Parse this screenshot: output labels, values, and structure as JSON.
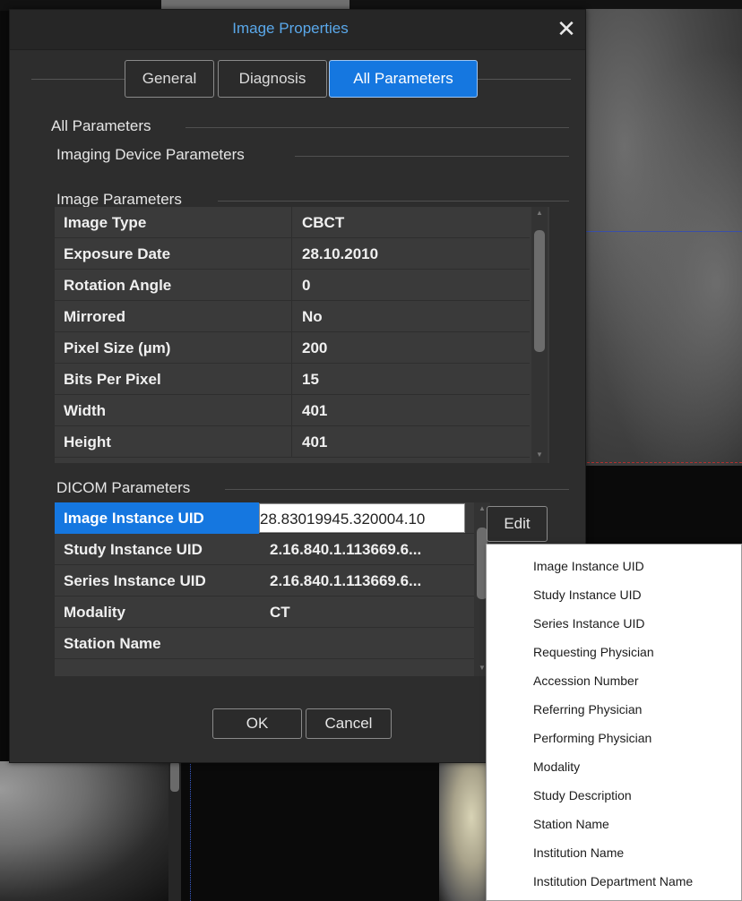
{
  "dialog": {
    "title": "Image Properties",
    "close_glyph": "✕",
    "tabs": [
      {
        "label": "General",
        "active": false
      },
      {
        "label": "Diagnosis",
        "active": false
      },
      {
        "label": "All Parameters",
        "active": true
      }
    ]
  },
  "sections": {
    "all_parameters": "All Parameters",
    "imaging_device": "Imaging Device Parameters",
    "image_parameters": "Image Parameters",
    "dicom_parameters": "DICOM Parameters"
  },
  "image_parameters": [
    {
      "key": "Image Type",
      "value": "CBCT"
    },
    {
      "key": "Exposure Date",
      "value": "28.10.2010"
    },
    {
      "key": "Rotation Angle",
      "value": "0"
    },
    {
      "key": "Mirrored",
      "value": "No"
    },
    {
      "key": "Pixel Size (µm)",
      "value": "200"
    },
    {
      "key": "Bits Per Pixel",
      "value": "15"
    },
    {
      "key": "Width",
      "value": "401"
    },
    {
      "key": "Height",
      "value": "401"
    }
  ],
  "dicom_parameters": [
    {
      "key": "Image Instance UID",
      "value": "28.83019945.320004.10",
      "selected": true,
      "editing": true
    },
    {
      "key": "Study Instance UID",
      "value": "2.16.840.1.113669.6..."
    },
    {
      "key": "Series Instance UID",
      "value": "2.16.840.1.113669.6..."
    },
    {
      "key": "Modality",
      "value": "CT"
    },
    {
      "key": "Station Name",
      "value": ""
    }
  ],
  "buttons": {
    "edit": "Edit",
    "ok": "OK",
    "cancel": "Cancel"
  },
  "context_menu": [
    "Image Instance UID",
    "Study Instance UID",
    "Series Instance UID",
    "Requesting Physician",
    "Accession Number",
    "Referring Physician",
    "Performing Physician",
    "Modality",
    "Study Description",
    "Station Name",
    "Institution Name",
    "Institution Department Name"
  ],
  "colors": {
    "accent": "#1577e0",
    "title": "#5aa8ea",
    "dialog_bg": "#2d2d2d",
    "table_bg": "#3a3a3a"
  }
}
